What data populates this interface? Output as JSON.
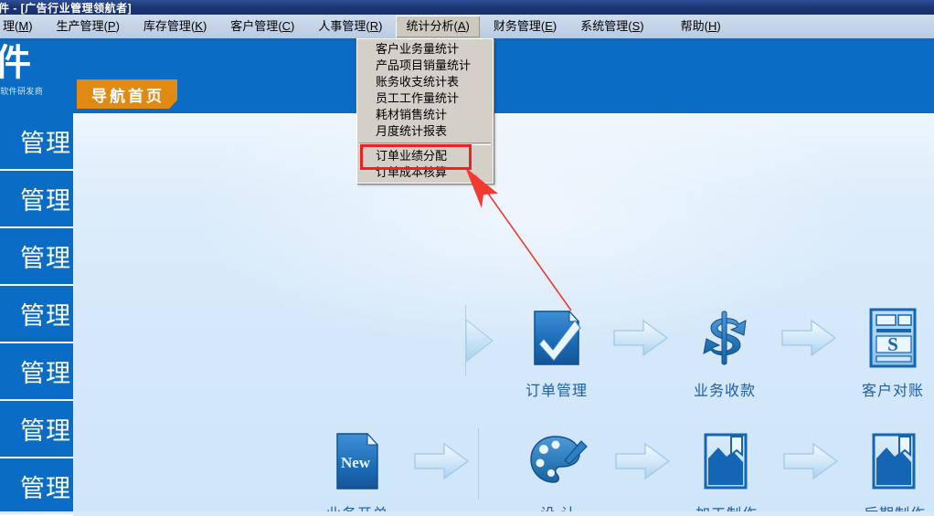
{
  "window": {
    "title": "件 - [广告行业管理领航者]"
  },
  "menubar": {
    "items": [
      {
        "label": "理",
        "key": "M"
      },
      {
        "label": "生产管理",
        "key": "P"
      },
      {
        "label": "库存管理",
        "key": "K"
      },
      {
        "label": "客户管理",
        "key": "C"
      },
      {
        "label": "人事管理",
        "key": "R"
      },
      {
        "label": "统计分析",
        "key": "A"
      },
      {
        "label": "财务管理",
        "key": "E"
      },
      {
        "label": "系统管理",
        "key": "S"
      },
      {
        "label": "帮助",
        "key": "H"
      }
    ],
    "active_index": 5
  },
  "dropdown": {
    "owner": "统计分析(A)",
    "items": [
      "客户业务量统计",
      "产品项目销量统计",
      "账务收支统计表",
      "员工工作量统计",
      "耗材销售统计",
      "月度统计报表"
    ],
    "items_after_separator": [
      "订单业绩分配",
      "订单成本核算"
    ],
    "highlighted": "订单业绩分配",
    "highlight_color": "#ee2222"
  },
  "banner": {
    "logo_text": "软件",
    "logo_sub": "业管理软件研发商",
    "nav_tab": "导航首页",
    "bg_color": "#0a6cc4",
    "tab_color": "#e08a14"
  },
  "sidebar": {
    "items": [
      {
        "label": "管理"
      },
      {
        "label": "管理"
      },
      {
        "label": "管理"
      },
      {
        "label": "管理"
      },
      {
        "label": "管理"
      },
      {
        "label": "管理"
      },
      {
        "label": "管理"
      }
    ]
  },
  "flow": {
    "row1": [
      {
        "label": "订单管理",
        "icon": "checkmark-document-icon"
      },
      {
        "label": "业务收款",
        "icon": "dollar-exchange-icon"
      },
      {
        "label": "客户对账",
        "icon": "statement-document-icon"
      }
    ],
    "row2": [
      {
        "label": "业务开单",
        "icon": "new-document-icon"
      },
      {
        "label": "设 计",
        "icon": "palette-icon"
      },
      {
        "label": "加工制作",
        "icon": "image-edit-icon"
      },
      {
        "label": "后期制作",
        "icon": "image-edit-icon"
      }
    ],
    "arrow_icon": "right-arrow-icon",
    "accent_color": "#1b5fa8"
  },
  "annotation": {
    "arrow_color": "#f23a30",
    "from": "订单管理",
    "to": "订单业绩分配"
  }
}
